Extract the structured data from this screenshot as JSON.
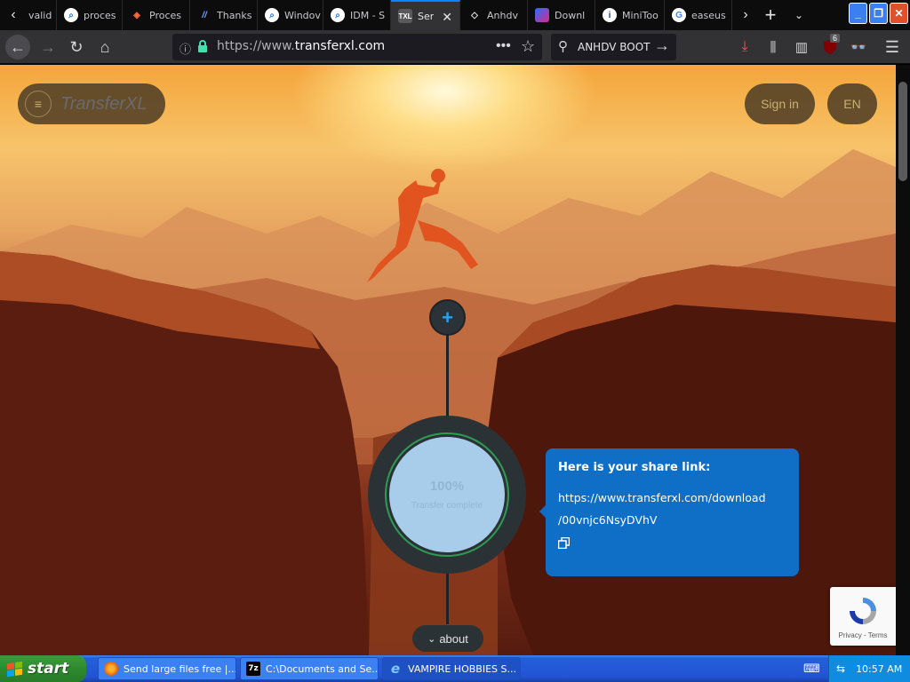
{
  "browser": {
    "tabs": [
      {
        "label": "valid",
        "icon": "back-arrow-icon"
      },
      {
        "label": "proces",
        "icon": "magnifier-icon"
      },
      {
        "label": "Proces",
        "icon": "diamond-icon"
      },
      {
        "label": "Thanks",
        "icon": "vs-icon"
      },
      {
        "label": "Windov",
        "icon": "magnifier-icon"
      },
      {
        "label": "IDM - S",
        "icon": "magnifier-icon"
      },
      {
        "label": "Ser",
        "icon": "txl-icon",
        "active": true
      },
      {
        "label": "Anhdv",
        "icon": "diamond-outline-icon"
      },
      {
        "label": "Downl",
        "icon": "gradient-icon"
      },
      {
        "label": "MiniToo",
        "icon": "minitool-icon"
      },
      {
        "label": "easeus",
        "icon": "google-icon"
      }
    ],
    "url": {
      "prefix": "https://www.",
      "domain": "transferxl.com"
    },
    "search_text": "ANHDV BOOT",
    "ublock_count": "6"
  },
  "page": {
    "brand": "TransferXL",
    "signin_label": "Sign in",
    "lang_label": "EN",
    "add_label": "+",
    "circle_line1": "100%",
    "circle_line2": "Transfer complete",
    "share": {
      "title": "Here is your share link:",
      "link_line1": "https://www.transferxl.com/download",
      "link_line2": "/00vnjc6NsyDVhV"
    },
    "about_label": "about",
    "recaptcha_links": "Privacy - Terms"
  },
  "taskbar": {
    "start_label": "start",
    "tasks": [
      {
        "label": "Send large files free |...",
        "icon": "firefox-icon"
      },
      {
        "label": "C:\\Documents and Se...",
        "icon": "7zip-icon"
      },
      {
        "label": "VAMPIRE HOBBIES S...",
        "icon": "ie-icon"
      }
    ],
    "clock": "10:57 AM"
  }
}
